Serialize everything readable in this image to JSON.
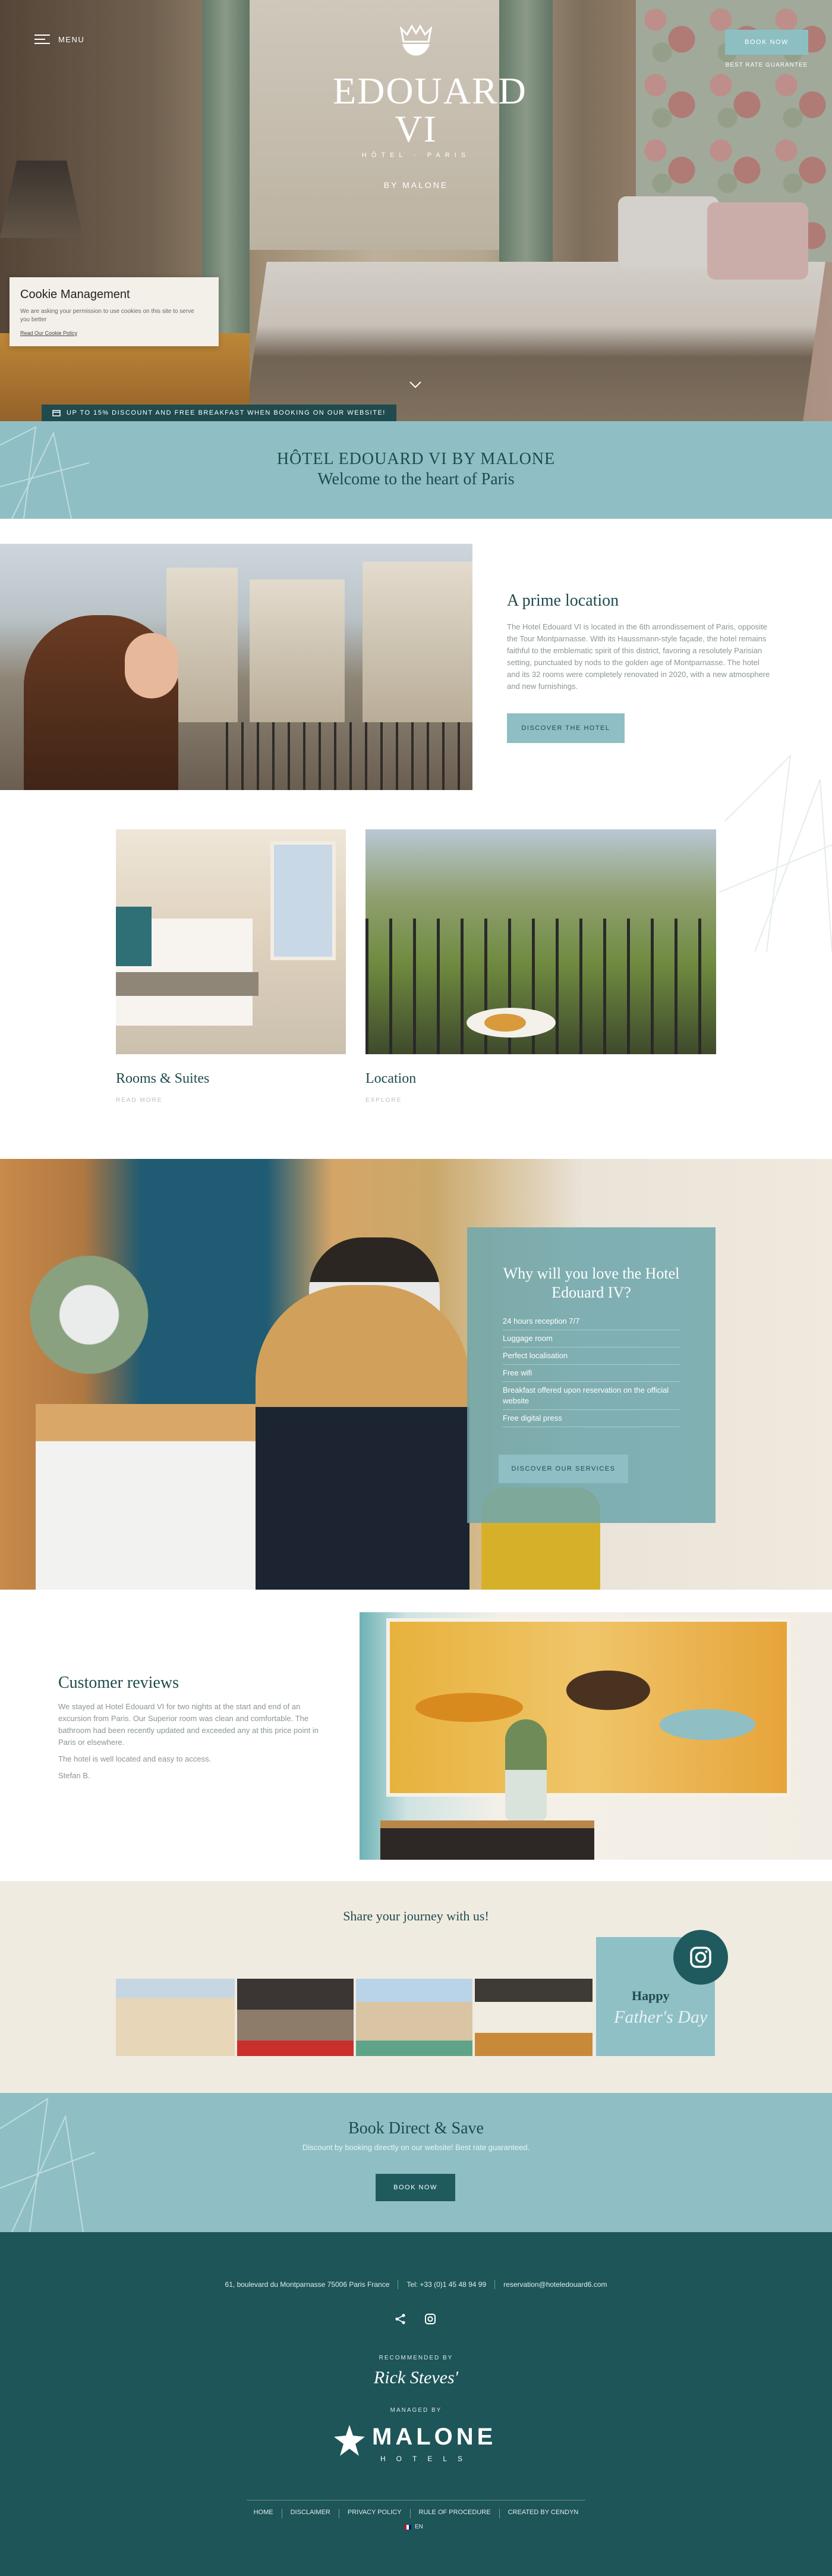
{
  "header": {
    "menu_label": "MENU",
    "logo_name": "EDOUARD VI",
    "logo_sub": "HÔTEL · PARIS",
    "logo_by": "BY MALONE",
    "book_now_label": "BOOK NOW",
    "best_rate_label": "BEST RATE GUARANTEE"
  },
  "cookie": {
    "title": "Cookie Management",
    "text": "We are asking your permission to use cookies on this site to serve you better",
    "link": "Read Our Cookie Policy"
  },
  "promo": {
    "text": "UP TO 15% DISCOUNT AND FREE BREAKFAST WHEN BOOKING ON OUR WEBSITE!"
  },
  "welcome": {
    "line1": "HÔTEL EDOUARD VI BY MALONE",
    "line2": "Welcome to the heart of Paris"
  },
  "prime": {
    "title": "A prime location",
    "text": "The Hotel Edouard VI is located in the 6th arrondissement of Paris, opposite the Tour Montparnasse. With its Haussmann-style façade, the hotel remains faithful to the emblematic spirit of this district, favoring a resolutely Parisian setting, punctuated by nods to the golden age of Montparnasse. The hotel and its 32 rooms were completely renovated in 2020, with a new atmosphere and new furnishings.",
    "button": "DISCOVER THE HOTEL"
  },
  "cards": [
    {
      "title": "Rooms & Suites",
      "link": "READ MORE"
    },
    {
      "title": "Location",
      "link": "EXPLORE"
    }
  ],
  "services": {
    "title": "Why will you love the Hotel Edouard IV?",
    "items": [
      "24 hours reception 7/7",
      "Luggage room",
      "Perfect localisation",
      "Free wifi",
      "Breakfast offered upon reservation on the official website",
      "Free digital press"
    ],
    "button": "DISCOVER OUR SERVICES"
  },
  "reviews": {
    "title": "Customer reviews",
    "text": "We stayed at Hotel Edouard VI for two nights at the start and end of an excursion from Paris. Our Superior room was clean and comfortable. The bathroom had been recently updated and exceeded any at this price point in Paris or elsewhere.",
    "text2": "The hotel is well located and easy to access.",
    "author": "Stefan B."
  },
  "social": {
    "title": "Share your journey with us!",
    "tile_happy": "Happy",
    "tile_fathers": "Father's Day",
    "badge_icon": "instagram-icon"
  },
  "book_direct": {
    "title": "Book Direct & Save",
    "text": "Discount by booking directly on our website! Best rate guaranteed.",
    "button": "BOOK NOW"
  },
  "footer": {
    "address": "61, boulevard du Montparnasse 75006 Paris France",
    "phone": "Tel: +33 (0)1 45 48 94 99",
    "email": "reservation@hoteledouard6.com",
    "recommended_by": "RECOMMENDED BY",
    "rick": "Rick Steves'",
    "managed_by": "MANAGED BY",
    "malone": "MALONE",
    "malone_sub": "HOTELS",
    "nav": [
      "HOME",
      "DISCLAIMER",
      "PRIVACY POLICY",
      "RULE OF PROCEDURE",
      "CREATED BY CENDYN"
    ],
    "lang": "EN"
  },
  "colors": {
    "teal_light": "#8fbfc4",
    "teal_dark": "#1d5558",
    "cream": "#f0ebe1"
  }
}
